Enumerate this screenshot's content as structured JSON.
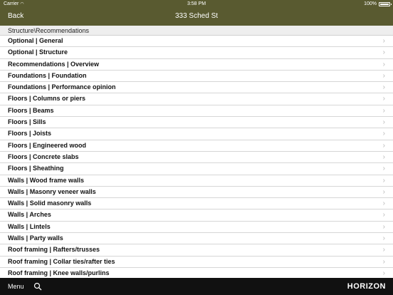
{
  "status_bar": {
    "carrier": "Carrier",
    "wifi_icon": "wifi-icon",
    "time": "3:58 PM",
    "battery": "100%"
  },
  "nav": {
    "back_label": "Back",
    "title": "333 Sched St"
  },
  "section_header": "Structure\\Recommendations",
  "rows": [
    "Optional | General",
    "Optional | Structure",
    "Recommendations | Overview",
    "Foundations | Foundation",
    "Foundations | Performance opinion",
    "Floors | Columns or piers",
    "Floors | Beams",
    "Floors | Sills",
    "Floors | Joists",
    "Floors | Engineered wood",
    "Floors | Concrete slabs",
    "Floors | Sheathing",
    "Walls | Wood frame walls",
    "Walls | Masonry veneer walls",
    "Walls | Solid masonry walls",
    "Walls | Arches",
    "Walls | Lintels",
    "Walls | Party walls",
    "Roof framing | Rafters/trusses",
    "Roof framing | Collar ties/rafter ties",
    "Roof framing | Knee walls/purlins"
  ],
  "chevron_glyph": "›",
  "footer": {
    "menu_label": "Menu",
    "logo": "HORIZON"
  },
  "colors": {
    "bar": "#595a30",
    "footer": "#111111",
    "section_bg": "#eeeeee"
  }
}
